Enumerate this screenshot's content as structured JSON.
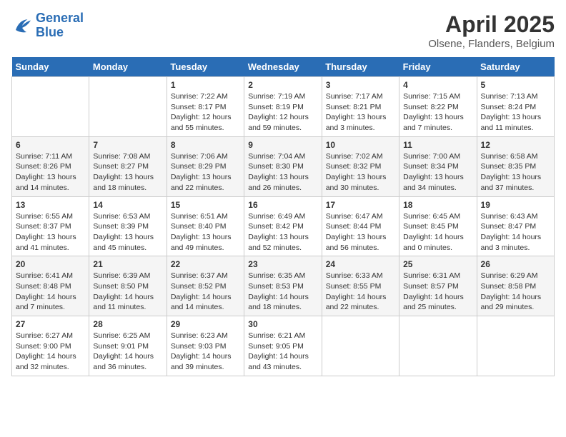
{
  "header": {
    "logo_line1": "General",
    "logo_line2": "Blue",
    "month_title": "April 2025",
    "location": "Olsene, Flanders, Belgium"
  },
  "days_of_week": [
    "Sunday",
    "Monday",
    "Tuesday",
    "Wednesday",
    "Thursday",
    "Friday",
    "Saturday"
  ],
  "weeks": [
    [
      {
        "day": "",
        "info": ""
      },
      {
        "day": "",
        "info": ""
      },
      {
        "day": "1",
        "info": "Sunrise: 7:22 AM\nSunset: 8:17 PM\nDaylight: 12 hours and 55 minutes."
      },
      {
        "day": "2",
        "info": "Sunrise: 7:19 AM\nSunset: 8:19 PM\nDaylight: 12 hours and 59 minutes."
      },
      {
        "day": "3",
        "info": "Sunrise: 7:17 AM\nSunset: 8:21 PM\nDaylight: 13 hours and 3 minutes."
      },
      {
        "day": "4",
        "info": "Sunrise: 7:15 AM\nSunset: 8:22 PM\nDaylight: 13 hours and 7 minutes."
      },
      {
        "day": "5",
        "info": "Sunrise: 7:13 AM\nSunset: 8:24 PM\nDaylight: 13 hours and 11 minutes."
      }
    ],
    [
      {
        "day": "6",
        "info": "Sunrise: 7:11 AM\nSunset: 8:26 PM\nDaylight: 13 hours and 14 minutes."
      },
      {
        "day": "7",
        "info": "Sunrise: 7:08 AM\nSunset: 8:27 PM\nDaylight: 13 hours and 18 minutes."
      },
      {
        "day": "8",
        "info": "Sunrise: 7:06 AM\nSunset: 8:29 PM\nDaylight: 13 hours and 22 minutes."
      },
      {
        "day": "9",
        "info": "Sunrise: 7:04 AM\nSunset: 8:30 PM\nDaylight: 13 hours and 26 minutes."
      },
      {
        "day": "10",
        "info": "Sunrise: 7:02 AM\nSunset: 8:32 PM\nDaylight: 13 hours and 30 minutes."
      },
      {
        "day": "11",
        "info": "Sunrise: 7:00 AM\nSunset: 8:34 PM\nDaylight: 13 hours and 34 minutes."
      },
      {
        "day": "12",
        "info": "Sunrise: 6:58 AM\nSunset: 8:35 PM\nDaylight: 13 hours and 37 minutes."
      }
    ],
    [
      {
        "day": "13",
        "info": "Sunrise: 6:55 AM\nSunset: 8:37 PM\nDaylight: 13 hours and 41 minutes."
      },
      {
        "day": "14",
        "info": "Sunrise: 6:53 AM\nSunset: 8:39 PM\nDaylight: 13 hours and 45 minutes."
      },
      {
        "day": "15",
        "info": "Sunrise: 6:51 AM\nSunset: 8:40 PM\nDaylight: 13 hours and 49 minutes."
      },
      {
        "day": "16",
        "info": "Sunrise: 6:49 AM\nSunset: 8:42 PM\nDaylight: 13 hours and 52 minutes."
      },
      {
        "day": "17",
        "info": "Sunrise: 6:47 AM\nSunset: 8:44 PM\nDaylight: 13 hours and 56 minutes."
      },
      {
        "day": "18",
        "info": "Sunrise: 6:45 AM\nSunset: 8:45 PM\nDaylight: 14 hours and 0 minutes."
      },
      {
        "day": "19",
        "info": "Sunrise: 6:43 AM\nSunset: 8:47 PM\nDaylight: 14 hours and 3 minutes."
      }
    ],
    [
      {
        "day": "20",
        "info": "Sunrise: 6:41 AM\nSunset: 8:48 PM\nDaylight: 14 hours and 7 minutes."
      },
      {
        "day": "21",
        "info": "Sunrise: 6:39 AM\nSunset: 8:50 PM\nDaylight: 14 hours and 11 minutes."
      },
      {
        "day": "22",
        "info": "Sunrise: 6:37 AM\nSunset: 8:52 PM\nDaylight: 14 hours and 14 minutes."
      },
      {
        "day": "23",
        "info": "Sunrise: 6:35 AM\nSunset: 8:53 PM\nDaylight: 14 hours and 18 minutes."
      },
      {
        "day": "24",
        "info": "Sunrise: 6:33 AM\nSunset: 8:55 PM\nDaylight: 14 hours and 22 minutes."
      },
      {
        "day": "25",
        "info": "Sunrise: 6:31 AM\nSunset: 8:57 PM\nDaylight: 14 hours and 25 minutes."
      },
      {
        "day": "26",
        "info": "Sunrise: 6:29 AM\nSunset: 8:58 PM\nDaylight: 14 hours and 29 minutes."
      }
    ],
    [
      {
        "day": "27",
        "info": "Sunrise: 6:27 AM\nSunset: 9:00 PM\nDaylight: 14 hours and 32 minutes."
      },
      {
        "day": "28",
        "info": "Sunrise: 6:25 AM\nSunset: 9:01 PM\nDaylight: 14 hours and 36 minutes."
      },
      {
        "day": "29",
        "info": "Sunrise: 6:23 AM\nSunset: 9:03 PM\nDaylight: 14 hours and 39 minutes."
      },
      {
        "day": "30",
        "info": "Sunrise: 6:21 AM\nSunset: 9:05 PM\nDaylight: 14 hours and 43 minutes."
      },
      {
        "day": "",
        "info": ""
      },
      {
        "day": "",
        "info": ""
      },
      {
        "day": "",
        "info": ""
      }
    ]
  ]
}
